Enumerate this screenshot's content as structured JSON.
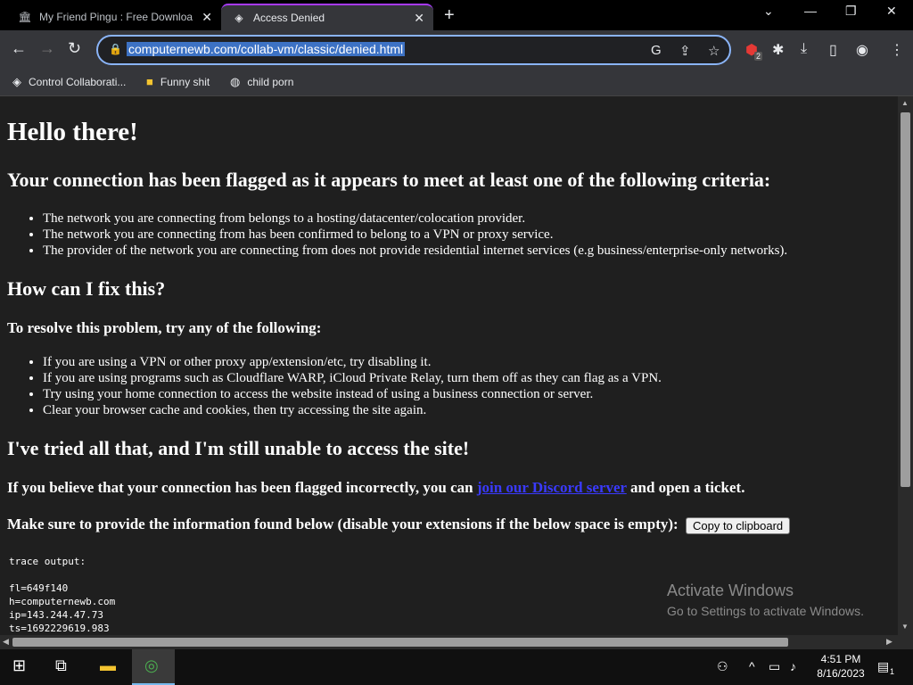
{
  "tabs": [
    {
      "title": "My Friend Pingu : Free Downloa"
    },
    {
      "title": "Access Denied"
    }
  ],
  "toolbar": {
    "url": "computernewb.com/collab-vm/classic/denied.html",
    "ext_badge": "2"
  },
  "bookmarks": [
    {
      "label": "Control Collaborati..."
    },
    {
      "label": "Funny shit"
    },
    {
      "label": "child porn"
    }
  ],
  "page": {
    "h1": "Hello there!",
    "h2_flagged": "Your connection has been flagged as it appears to meet at least one of the following criteria:",
    "criteria": [
      "The network you are connecting from belongs to a hosting/datacenter/colocation provider.",
      "The network you are connecting from has been confirmed to belong to a VPN or proxy service.",
      "The provider of the network you are connecting from does not provide residential internet services (e.g business/enterprise-only networks)."
    ],
    "h2_fix": "How can I fix this?",
    "h3_resolve": "To resolve this problem, try any of the following:",
    "fixes": [
      "If you are using a VPN or other proxy app/extension/etc, try disabling it.",
      "If you are using programs such as Cloudflare WARP, iCloud Private Relay, turn them off as they can flag as a VPN.",
      "Try using your home connection to access the website instead of using a business connection or server.",
      "Clear your browser cache and cookies, then try accessing the site again."
    ],
    "h2_tried": "I've tried all that, and I'm still unable to access the site!",
    "believe_pre": "If you believe that your connection has been flagged incorrectly, you can",
    "believe_link": "join our Discord server",
    "believe_post": "and open a ticket.",
    "provide_text": "Make sure to provide the information found below (disable your extensions if the below space is empty):",
    "copy_button": "Copy to clipboard",
    "trace": "trace output:\n\nfl=649f140\nh=computernewb.com\nip=143.244.47.73\nts=1692229619.983"
  },
  "watermark": {
    "line1": "Activate Windows",
    "line2": "Go to Settings to activate Windows."
  },
  "taskbar": {
    "time": "4:51 PM",
    "date": "8/16/2023",
    "notif_count": "1"
  }
}
